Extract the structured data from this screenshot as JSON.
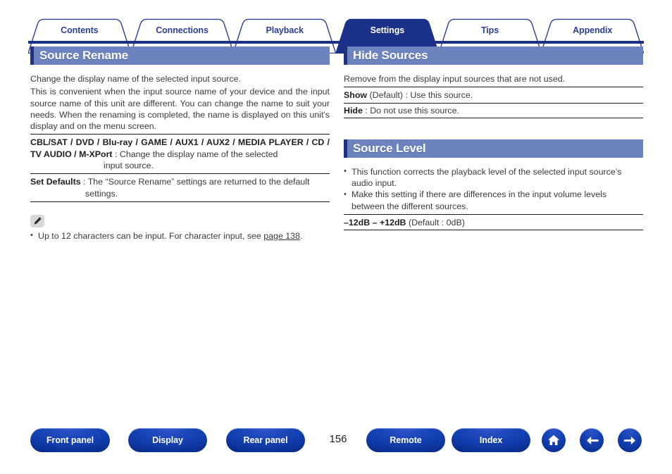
{
  "tabs": [
    {
      "label": "Contents",
      "active": false
    },
    {
      "label": "Connections",
      "active": false
    },
    {
      "label": "Playback",
      "active": false
    },
    {
      "label": "Settings",
      "active": true
    },
    {
      "label": "Tips",
      "active": false
    },
    {
      "label": "Appendix",
      "active": false
    }
  ],
  "colors": {
    "tab_label": "#2b3f96",
    "tab_active_bg": "#1b3087",
    "section_header_bg": "#6d83c0",
    "section_header_accent": "#22307d",
    "button_blue": "#123fb0"
  },
  "left_column": {
    "section_title": "Source Rename",
    "intro_line_1": "Change the display name of the selected input source.",
    "intro_line_2": "This is convenient when the input source name of your device and the input source name of this unit are different. You can change the name to suit your needs. When the renaming is completed, the name is displayed on this unit's display and on the menu screen.",
    "entries": [
      {
        "term": "CBL/SAT / DVD / Blu-ray / GAME / AUX1 / AUX2 / MEDIA PLAYER / CD / TV AUDIO / M-XPort",
        "separator": " : ",
        "description": "Change the display name of the selected",
        "description_cont": "input source."
      },
      {
        "term": "Set Defaults",
        "separator": " : ",
        "description": "The “Source Rename” settings are returned to the default",
        "description_cont": "settings."
      }
    ],
    "note": {
      "icon": "pencil-icon",
      "text_before_link": "Up to 12 characters can be input. For character input, see ",
      "link_text": "page 138",
      "text_after_link": "."
    }
  },
  "right_column": {
    "sections": [
      {
        "section_title": "Hide Sources",
        "intro": "Remove from the display input sources that are not used.",
        "entries": [
          {
            "term": "Show",
            "qualifier": " (Default)",
            "separator": " : ",
            "description": "Use this source."
          },
          {
            "term": "Hide",
            "qualifier": "",
            "separator": " : ",
            "description": "Do not use this source."
          }
        ]
      },
      {
        "section_title": "Source Level",
        "bullets": [
          {
            "text": "This function corrects the playback level of the selected input source’s",
            "cont": "audio input."
          },
          {
            "text": "Make this setting if there are differences in the input volume levels",
            "cont": "between the different sources."
          }
        ],
        "range": {
          "term": "–12dB – +12dB",
          "detail": " (Default : 0dB)"
        }
      }
    ]
  },
  "footer": {
    "buttons": [
      {
        "label": "Front panel"
      },
      {
        "label": "Display"
      },
      {
        "label": "Rear panel"
      },
      {
        "label": "Remote"
      },
      {
        "label": "Index"
      }
    ],
    "page_number": "156",
    "icon_buttons": [
      {
        "name": "home-icon"
      },
      {
        "name": "previous-arrow-icon"
      },
      {
        "name": "next-arrow-icon"
      }
    ]
  }
}
